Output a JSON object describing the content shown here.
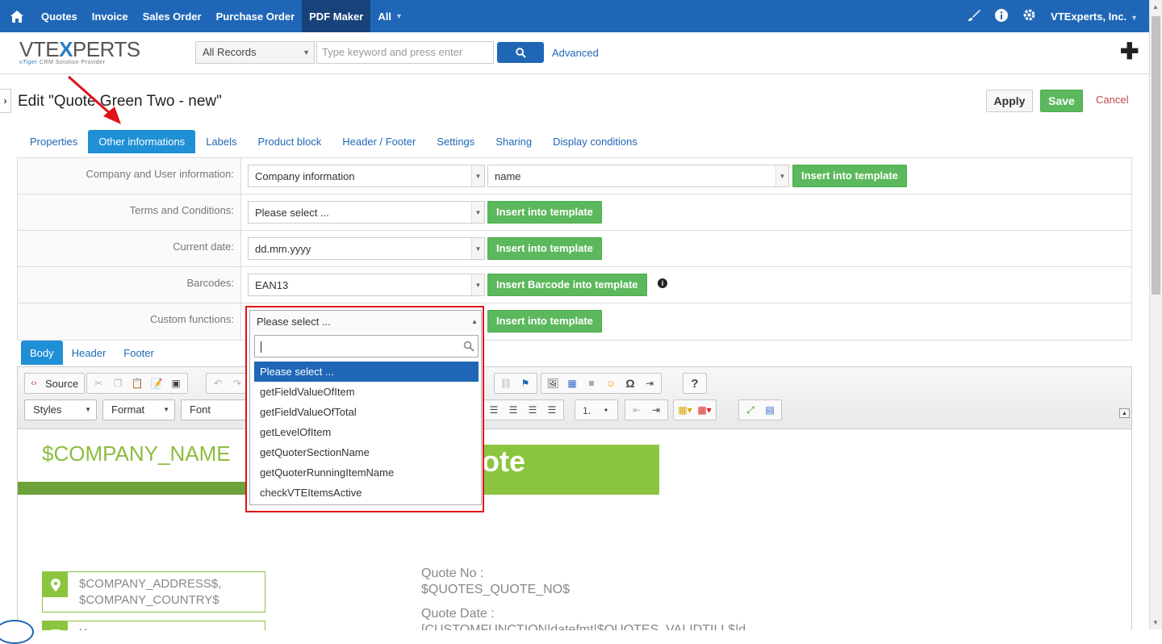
{
  "topnav": {
    "items": [
      "Quotes",
      "Invoice",
      "Sales Order",
      "Purchase Order",
      "PDF Maker",
      "All"
    ],
    "active_index": 4,
    "account": "VTExperts, Inc."
  },
  "logo": {
    "main_a": "VTE",
    "main_b": "X",
    "main_c": "PERTS",
    "tagline_a": "vTiger",
    "tagline_b": " CRM Solution Provider"
  },
  "search": {
    "scope": "All Records",
    "placeholder": "Type keyword and press enter",
    "advanced": "Advanced"
  },
  "page": {
    "title": "Edit \"Quote Green Two - new\"",
    "apply": "Apply",
    "save": "Save",
    "cancel": "Cancel"
  },
  "tabs": [
    "Properties",
    "Other informations",
    "Labels",
    "Product block",
    "Header / Footer",
    "Settings",
    "Sharing",
    "Display conditions"
  ],
  "active_tab": 1,
  "form": {
    "company_label": "Company and User information:",
    "company_select": "Company information",
    "company_field": "name",
    "terms_label": "Terms and Conditions:",
    "terms_select": "Please select ...",
    "date_label": "Current date:",
    "date_select": "dd.mm.yyyy",
    "barcode_label": "Barcodes:",
    "barcode_select": "EAN13",
    "barcode_button": "Insert Barcode into template",
    "custom_label": "Custom functions:",
    "custom_select": "Please select ...",
    "insert_button": "Insert into template"
  },
  "subtabs": [
    "Body",
    "Header",
    "Footer"
  ],
  "editor": {
    "source": "Source",
    "styles": "Styles",
    "format": "Format",
    "font": "Font",
    "company_name": "$COMPANY_NAME",
    "banner": "ote",
    "address_line1": "$COMPANY_ADDRESS$,",
    "address_line2": "$COMPANY_COUNTRY$",
    "email_partial": "Y",
    "quote_no_label": "Quote No :",
    "quote_no_value": "$QUOTES_QUOTE_NO$",
    "quote_date_label": "Quote Date :",
    "quote_date_value": "[CUSTOMFUNCTION|datefmt|$QUOTES_VALIDTILL$|d"
  },
  "dropdown": {
    "options": [
      "Please select ...",
      "getFieldValueOfItem",
      "getFieldValueOfTotal",
      "getLevelOfItem",
      "getQuoterSectionName",
      "getQuoterRunningItemName",
      "checkVTEItemsActive"
    ],
    "highlighted": 0
  },
  "colors": {
    "primary": "#1f67b6",
    "green": "#5cb85c",
    "accent_red": "#e0121a",
    "brand_green": "#8bc53f"
  }
}
